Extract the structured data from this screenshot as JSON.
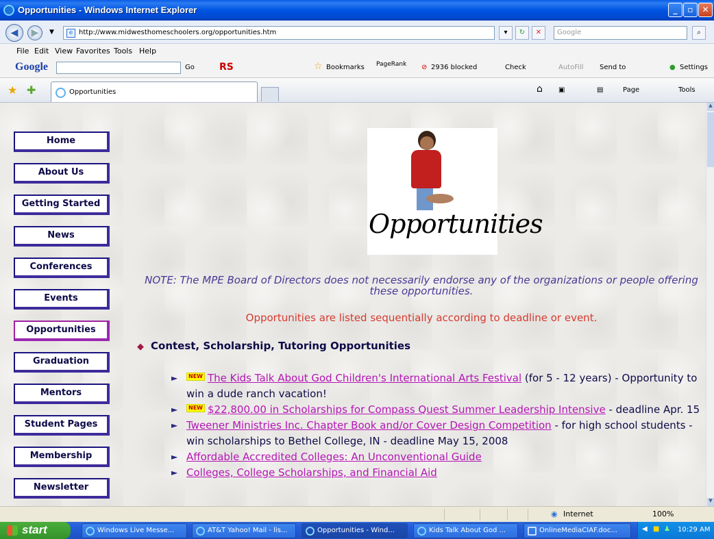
{
  "window": {
    "title": "Opportunities - Windows Internet Explorer",
    "min": "_",
    "max": "▫",
    "close": "✕"
  },
  "address": {
    "url": "http://www.midwesthomeschoolers.org/opportunities.htm",
    "search_placeholder": "Google"
  },
  "menu": [
    "File",
    "Edit",
    "View",
    "Favorites",
    "Tools",
    "Help"
  ],
  "google_toolbar": {
    "logo": "Google",
    "go": "Go",
    "rs": "RS",
    "bookmarks": "Bookmarks",
    "pagerank": "PageRank",
    "blocked": "2936 blocked",
    "check": "Check",
    "autofill": "AutoFill",
    "sendto": "Send to",
    "settings": "Settings"
  },
  "tab": {
    "label": "Opportunities"
  },
  "command_bar": {
    "page": "Page",
    "tools": "Tools"
  },
  "sidebar": {
    "items": [
      {
        "label": "Home"
      },
      {
        "label": "About Us"
      },
      {
        "label": "Getting Started"
      },
      {
        "label": "News"
      },
      {
        "label": "Conferences"
      },
      {
        "label": "Events"
      },
      {
        "label": "Opportunities",
        "active": true
      },
      {
        "label": "Graduation"
      },
      {
        "label": "Mentors"
      },
      {
        "label": "Student Pages"
      },
      {
        "label": "Membership"
      },
      {
        "label": "Newsletter"
      }
    ]
  },
  "hero": {
    "caption": "Opportunities"
  },
  "note": "NOTE: The MPE Board of Directors does not necessarily endorse any of the organizations or people offering these opportunities.",
  "sequence_note": "Opportunities are listed sequentially according to deadline or event.",
  "section": {
    "title": "Contest, Scholarship, Tutoring Opportunities"
  },
  "new_badge": "NEW",
  "opportunities": [
    {
      "is_new": true,
      "link": "The Kids Talk About God Children's International Arts Festival",
      "suffix": " (for 5 - 12 years) - Opportunity to win a dude ranch vacation!"
    },
    {
      "is_new": true,
      "link": "$22,800.00 in Scholarships for Compass Quest Summer Leadership Intensive",
      "suffix": " - deadline Apr. 15"
    },
    {
      "is_new": false,
      "link": "Tweener Ministries Inc. Chapter Book and/or Cover Design Competition",
      "suffix": " - for high school students - win scholarships to Bethel College, IN - deadline May 15, 2008"
    },
    {
      "is_new": false,
      "link": "Affordable Accredited Colleges: An Unconventional Guide",
      "suffix": ""
    },
    {
      "is_new": false,
      "link": "Colleges, College Scholarships, and Financial Aid",
      "suffix": ""
    }
  ],
  "status": {
    "zone": "Internet",
    "zoom": "100%"
  },
  "taskbar": {
    "start": "start",
    "tasks": [
      {
        "label": "Windows Live Messe..."
      },
      {
        "label": "AT&T Yahoo! Mail - lis..."
      },
      {
        "label": "Opportunities - Wind...",
        "active": true
      },
      {
        "label": "Kids Talk About God ..."
      },
      {
        "label": "OnlineMediaCIAF.doc..."
      }
    ],
    "clock": "10:29 AM"
  }
}
